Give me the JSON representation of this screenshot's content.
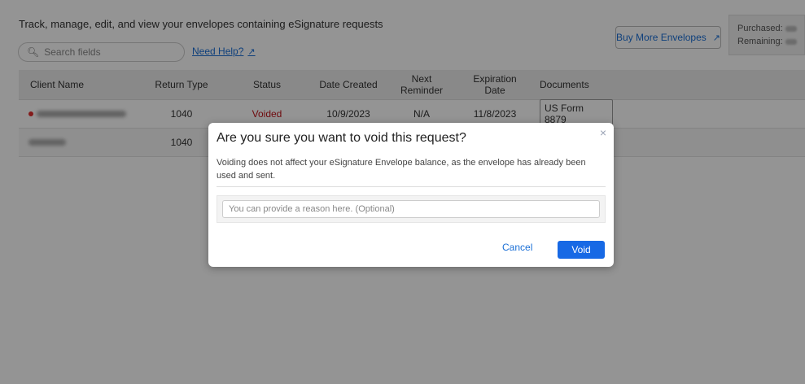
{
  "header": {
    "title": "Track, manage, edit, and view your envelopes containing eSignature requests",
    "search_placeholder": "Search fields",
    "help_link": "Need Help?",
    "buy_button": "Buy More Envelopes",
    "purchased_label": "Purchased:",
    "remaining_label": "Remaining:"
  },
  "table": {
    "columns": [
      "Client Name",
      "Return Type",
      "Status",
      "Date Created",
      "Next Reminder",
      "Expiration Date",
      "Documents"
    ],
    "rows": [
      {
        "return_type": "1040",
        "status": "Voided",
        "date_created": "10/9/2023",
        "next_reminder": "N/A",
        "expiration_date": "11/8/2023",
        "document": "US Form 8879"
      },
      {
        "return_type": "1040"
      }
    ]
  },
  "modal": {
    "title": "Are you sure you want to void this request?",
    "message": "Voiding does not affect your eSignature Envelope balance, as the envelope has already been used and sent.",
    "reason_placeholder": "You can provide a reason here. (Optional)",
    "cancel_label": "Cancel",
    "void_label": "Void",
    "close_icon": "×"
  },
  "colors": {
    "accent": "#1769e5",
    "link": "#1a6fd6",
    "voided": "#c0141a"
  }
}
